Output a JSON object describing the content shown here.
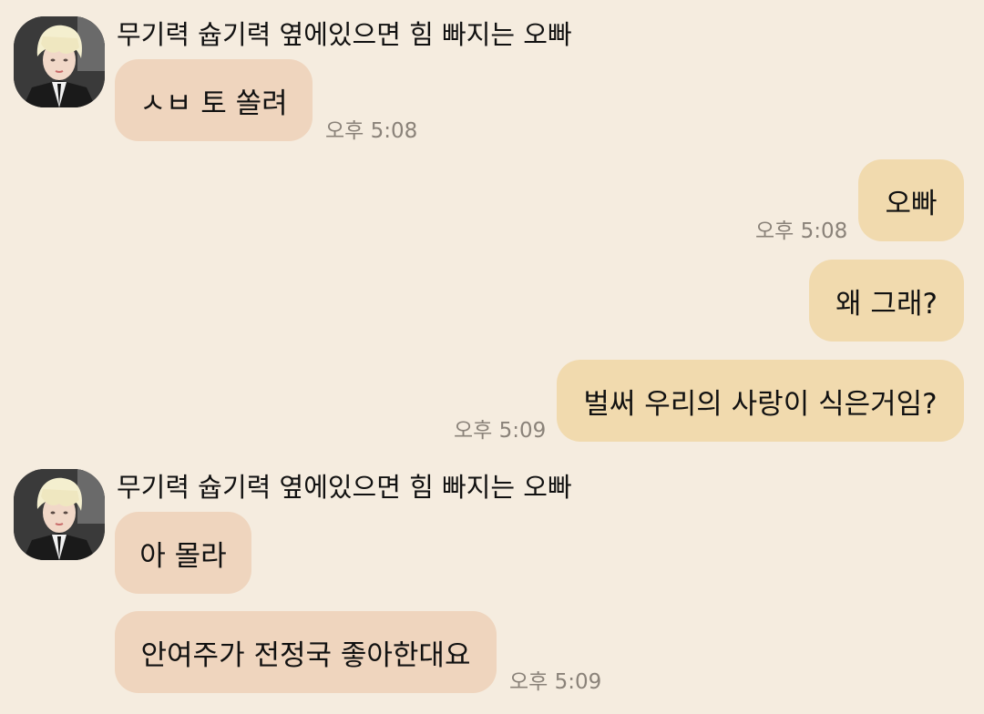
{
  "colors": {
    "background": "#F5ECDF",
    "incoming_bubble": "#EFD5BE",
    "outgoing_bubble": "#F1DAAE",
    "timestamp": "#8a8279"
  },
  "messages": {
    "group1": {
      "sender": "무기력 슙기력 옆에있으면 힘 빠지는 오빠",
      "avatar_icon": "profile-photo",
      "m1": "ㅅㅂ 토 쏠려",
      "time": "오후 5:08"
    },
    "out1": {
      "text": "오빠",
      "time": "오후 5:08"
    },
    "out2": {
      "text": "왜 그래?"
    },
    "out3": {
      "text": "벌써 우리의 사랑이 식은거임?",
      "time": "오후 5:09"
    },
    "group2": {
      "sender": "무기력 슙기력 옆에있으면 힘 빠지는 오빠",
      "avatar_icon": "profile-photo",
      "m1": "아 몰라",
      "m2": "안여주가 전정국 좋아한대요",
      "time": "오후 5:09"
    }
  }
}
